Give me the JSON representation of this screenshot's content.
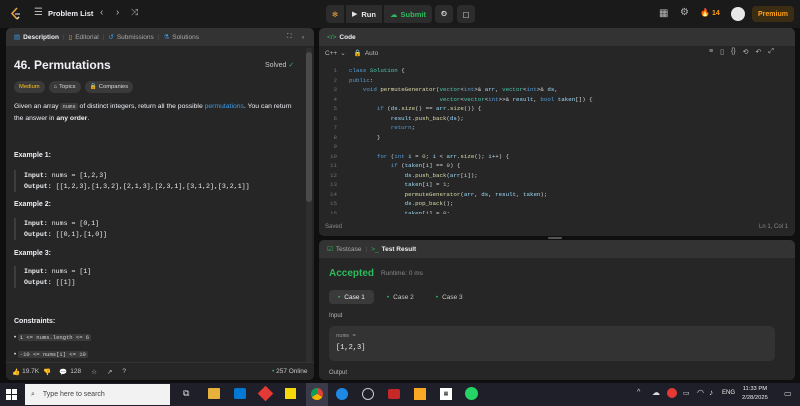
{
  "topbar": {
    "problem_list_label": "Problem List",
    "run_label": "Run",
    "submit_label": "Submit",
    "streak_count": "14",
    "premium_label": "Premium"
  },
  "left_panel": {
    "tabs": [
      {
        "label": "Description"
      },
      {
        "label": "Editorial"
      },
      {
        "label": "Submissions"
      },
      {
        "label": "Solutions"
      }
    ],
    "problem_title": "46. Permutations",
    "solved_label": "Solved",
    "tags": {
      "difficulty": "Medium",
      "topics": "Topics",
      "companies": "Companies"
    },
    "description": {
      "p1": "Given an array ",
      "code1": "nums",
      "p2": " of distinct integers, return all the possible ",
      "link": "permutations",
      "p3": ". You can return the answer in ",
      "bold": "any order",
      "p4": "."
    },
    "examples": [
      {
        "title": "Example 1:",
        "input_label": "Input:",
        "input": "nums = [1,2,3]",
        "output_label": "Output:",
        "output": "[[1,2,3],[1,3,2],[2,1,3],[2,3,1],[3,1,2],[3,2,1]]"
      },
      {
        "title": "Example 2:",
        "input_label": "Input:",
        "input": "nums = [0,1]",
        "output_label": "Output:",
        "output": "[[0,1],[1,0]]"
      },
      {
        "title": "Example 3:",
        "input_label": "Input:",
        "input": "nums = [1]",
        "output_label": "Output:",
        "output": "[[1]]"
      }
    ],
    "constraints_title": "Constraints:",
    "constraints": [
      "1 <= nums.length <= 6",
      "-10 <= nums[i] <= 10"
    ],
    "footer": {
      "likes": "19.7K",
      "comments": "128",
      "online": "257 Online"
    }
  },
  "code_panel": {
    "title": "Code",
    "language": "C++",
    "auto_label": "Auto",
    "lines": [
      {
        "n": "1",
        "t": "class Solution {"
      },
      {
        "n": "2",
        "t": "public:"
      },
      {
        "n": "3",
        "t": "    void permuteGenerator(vector<int>& arr, vector<int>& ds,"
      },
      {
        "n": "4",
        "t": "                          vector<vector<int>>& result, bool taken[]) {"
      },
      {
        "n": "5",
        "t": "        if (ds.size() == arr.size()) {"
      },
      {
        "n": "6",
        "t": "            result.push_back(ds);"
      },
      {
        "n": "7",
        "t": "            return;"
      },
      {
        "n": "8",
        "t": "        }"
      },
      {
        "n": "9",
        "t": ""
      },
      {
        "n": "10",
        "t": "        for (int i = 0; i < arr.size(); i++) {"
      },
      {
        "n": "11",
        "t": "            if (taken[i] == 0) {"
      },
      {
        "n": "12",
        "t": "                ds.push_back(arr[i]);"
      },
      {
        "n": "13",
        "t": "                taken[i] = 1;"
      },
      {
        "n": "14",
        "t": "                permuteGenerator(arr, ds, result, taken);"
      },
      {
        "n": "15",
        "t": "                ds.pop_back();"
      },
      {
        "n": "16",
        "t": "                taken[i] = 0;"
      }
    ],
    "status_left": "Saved",
    "status_right": "Ln 1, Col 1"
  },
  "result_panel": {
    "tab_testcase": "Testcase",
    "tab_result": "Test Result",
    "verdict": "Accepted",
    "runtime": "Runtime: 0 ms",
    "cases": [
      "Case 1",
      "Case 2",
      "Case 3"
    ],
    "input_label": "Input",
    "var_label": "nums =",
    "var_value": "[1,2,3]",
    "output_label": "Output"
  },
  "taskbar": {
    "search_placeholder": "Type here to search",
    "lang": "ENG",
    "time": "11:33 PM",
    "date": "2/28/2025"
  },
  "colors": {
    "accent_orange": "#ffa116",
    "green": "#2cbb5d",
    "medium_yellow": "#ffc01e",
    "link_blue": "#3c9be8"
  }
}
